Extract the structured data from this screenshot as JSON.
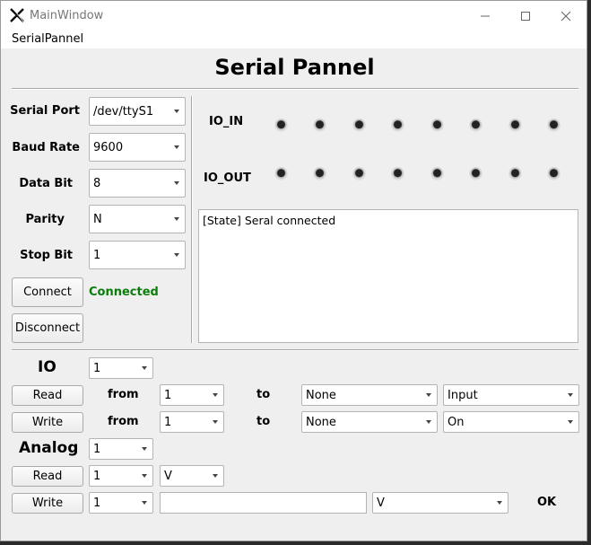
{
  "window": {
    "title": "MainWindow"
  },
  "menu": {
    "items": [
      "SerialPannel"
    ]
  },
  "heading": "Serial Pannel",
  "serial_config": {
    "port": {
      "label": "Serial Port",
      "value": "/dev/ttyS1"
    },
    "baud": {
      "label": "Baud Rate",
      "value": "9600"
    },
    "data": {
      "label": "Data Bit",
      "value": "8"
    },
    "parity": {
      "label": "Parity",
      "value": "N"
    },
    "stop": {
      "label": "Stop Bit",
      "value": "1"
    },
    "connect_label": "Connect",
    "status": "Connected",
    "status_color": "#0a7d0a",
    "disconnect_label": "Disconnect"
  },
  "io_panel": {
    "in_label": "IO_IN",
    "out_label": "IO_OUT",
    "led_count": 8
  },
  "log": {
    "text": "[State] Seral connected"
  },
  "io": {
    "label": "IO",
    "select": "1",
    "read": {
      "button": "Read",
      "from": "from",
      "from_value": "1",
      "to": "to",
      "to_value": "None",
      "mode": "Input"
    },
    "write": {
      "button": "Write",
      "from": "from",
      "from_value": "1",
      "to": "to",
      "to_value": "None",
      "mode": "On"
    }
  },
  "analog": {
    "label": "Analog",
    "select": "1",
    "read": {
      "button": "Read",
      "channel": "1",
      "unit": "V"
    },
    "write": {
      "button": "Write",
      "channel": "1",
      "value": "",
      "unit": "V",
      "result": "OK"
    }
  }
}
